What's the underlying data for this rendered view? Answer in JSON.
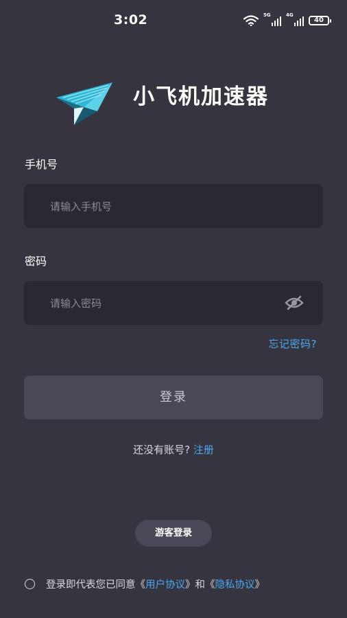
{
  "status_bar": {
    "time": "3:02",
    "net1": "5G",
    "net2": "4G",
    "battery": "40",
    "icons": [
      "wifi-icon",
      "signal-5g-icon",
      "signal-4g-icon",
      "battery-icon"
    ]
  },
  "header": {
    "logo_icon": "paper-plane-icon",
    "title": "小飞机加速器"
  },
  "form": {
    "phone_label": "手机号",
    "phone_placeholder": "请输入手机号",
    "password_label": "密码",
    "password_placeholder": "请输入密码",
    "eye_icon": "eye-off-icon",
    "forgot_link": "忘记密码?",
    "login_button": "登录"
  },
  "register": {
    "prompt": "还没有账号?",
    "link": "注册"
  },
  "guest_button": "游客登录",
  "agreement": {
    "prefix": "登录即代表您已同意",
    "open1": "《",
    "user_agreement": "用户协议",
    "close1": "》",
    "and": "和",
    "open2": "《",
    "privacy_policy": "隐私协议",
    "close2": "》"
  },
  "colors": {
    "background": "#36343f",
    "input_bg": "#2a2831",
    "button_bg": "#4a4857",
    "link": "#4aa8f0"
  }
}
